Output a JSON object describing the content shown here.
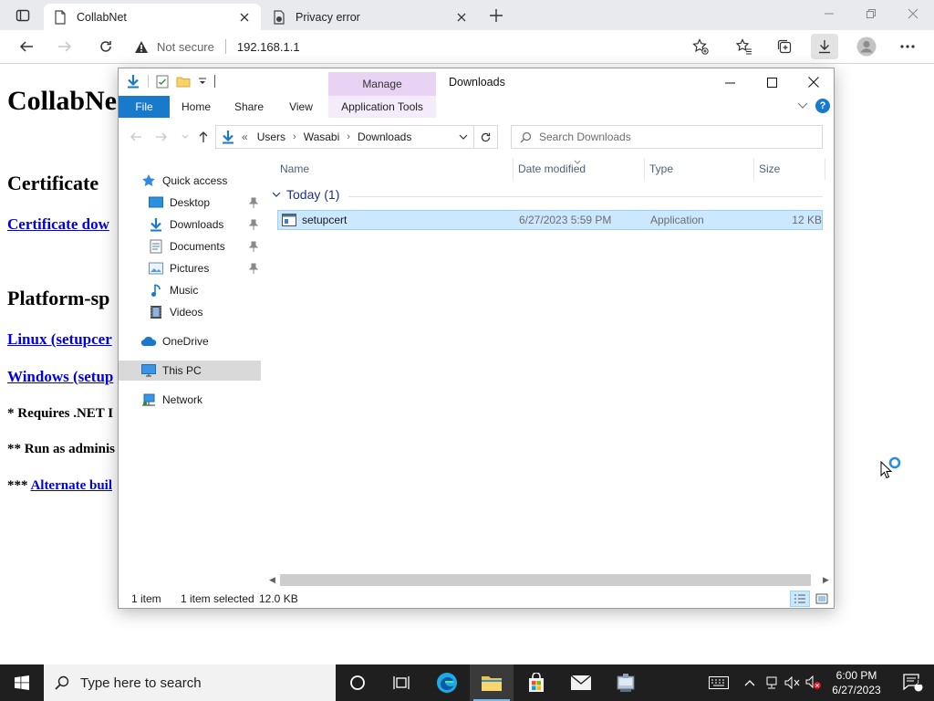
{
  "browser": {
    "tabs": [
      {
        "title": "CollabNet"
      },
      {
        "title": "Privacy error"
      }
    ],
    "address": {
      "security_text": "Not secure",
      "url": "192.168.1.1"
    }
  },
  "webpage": {
    "title": "CollabNe",
    "certificate_heading": "Certificate",
    "certificate_link": "Certificate dow",
    "platform_heading": "Platform-sp",
    "linux_link": "Linux (setupcer",
    "windows_link": "Windows (setup",
    "note1": "* Requires .NET I",
    "note2": "** Run as adminis",
    "note3_prefix": "***",
    "note3_link": "Alternate buil"
  },
  "explorer": {
    "manage_label": "Manage",
    "window_title": "Downloads",
    "ribbon_tabs": [
      "File",
      "Home",
      "Share",
      "View",
      "Application Tools"
    ],
    "breadcrumb": {
      "overflow": "«",
      "parts": [
        "Users",
        "Wasabi",
        "Downloads"
      ]
    },
    "search_placeholder": "Search Downloads",
    "nav": {
      "quick_access": "Quick access",
      "desktop": "Desktop",
      "downloads": "Downloads",
      "documents": "Documents",
      "pictures": "Pictures",
      "music": "Music",
      "videos": "Videos",
      "onedrive": "OneDrive",
      "this_pc": "This PC",
      "network": "Network"
    },
    "columns": [
      "Name",
      "Date modified",
      "Type",
      "Size"
    ],
    "group": "Today (1)",
    "files": [
      {
        "name": "setupcert",
        "date": "6/27/2023 5:59 PM",
        "type": "Application",
        "size": "12 KB"
      }
    ],
    "status": {
      "count": "1 item",
      "selection": "1 item selected",
      "size": "12.0 KB"
    }
  },
  "taskbar": {
    "search_placeholder": "Type here to search",
    "time": "6:00 PM",
    "date": "6/27/2023",
    "notification_count": "1"
  },
  "colors": {
    "accent": "#1979ca",
    "selection": "#cce8ff",
    "manage_tab": "#e8d3f5",
    "link": "#0000ee",
    "taskbar": "#1f1f1f"
  }
}
